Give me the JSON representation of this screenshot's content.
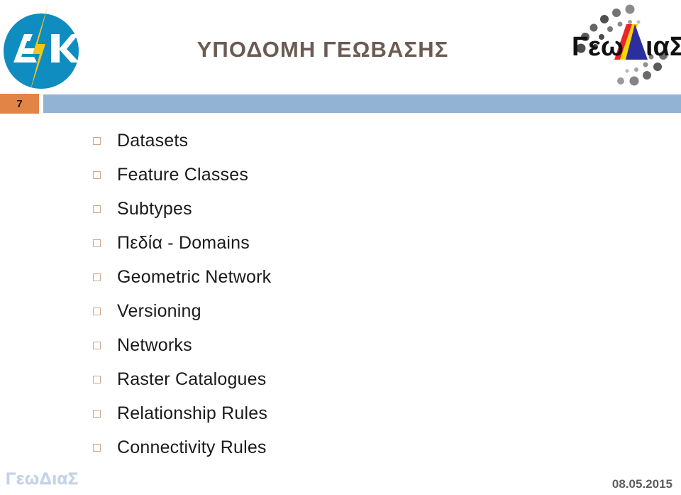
{
  "slide": {
    "title": "ΥΠΟΔΟΜΗ ΓΕΩΒΑΣΗΣ",
    "page_number": "7",
    "bullets": [
      {
        "label": "Datasets"
      },
      {
        "label": "Feature Classes"
      },
      {
        "label": "Subtypes"
      },
      {
        "label": "Πεδία - Domains"
      },
      {
        "label": "Geometric Network"
      },
      {
        "label": "Versioning"
      },
      {
        "label": "Networks"
      },
      {
        "label": "Raster Catalogues"
      },
      {
        "label": "Relationship Rules"
      },
      {
        "label": "Connectivity Rules"
      }
    ]
  },
  "brand_logo": {
    "name": "ahk-logo",
    "letters_left": "A",
    "letters_right": "K",
    "circle_color": "#0f8cc0",
    "bolt_color": "#f5c518",
    "letter_color": "#ffffff"
  },
  "partner_logo": {
    "name": "geodias-logo",
    "text_left": "Γεω",
    "text_right": "ιαΣ",
    "triangle_letter": "Δ",
    "triangle_colors": [
      "#e8252a",
      "#ffd400",
      "#2b2f9e"
    ],
    "text_color": "#111111",
    "dot_color": "#7a7a7a"
  },
  "footer": {
    "logo_text": "ΓεωΔιαΣ",
    "date": "08.05.2015"
  },
  "colors": {
    "title_text": "#6b5b52",
    "badge_bg": "#e18446",
    "rule_bg": "#92b3d4",
    "bullet_marker_border": "#cfa98b",
    "body_text": "#1a1a1a",
    "footer_logo": "#c3d3e8",
    "footer_date": "#5d5d5d"
  }
}
